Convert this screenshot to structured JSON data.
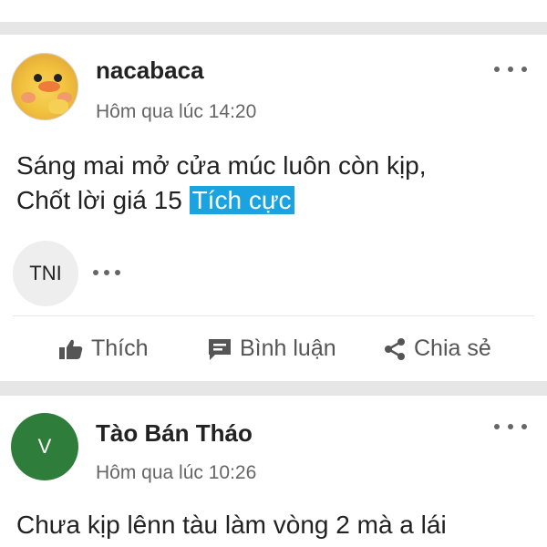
{
  "posts": [
    {
      "author": "nacabaca",
      "time": "Hôm qua lúc 14:20",
      "content_line1": "Sáng mai mở cửa múc luôn còn kịp,",
      "content_line2": "Chốt lời giá 15",
      "sentiment_tag": "Tích cực",
      "sentiment_color": "#1aa3e0",
      "reaction_chip": "TNI",
      "actions": {
        "like": "Thích",
        "comment": "Bình luận",
        "share": "Chia sẻ"
      }
    },
    {
      "author": "Tào Bán Tháo",
      "avatar_letter": "V",
      "avatar_color": "#2f7d3a",
      "time": "Hôm qua lúc 10:26",
      "content_line1": "Chưa kịp lênn tàu làm vòng 2 mà a lái"
    }
  ]
}
